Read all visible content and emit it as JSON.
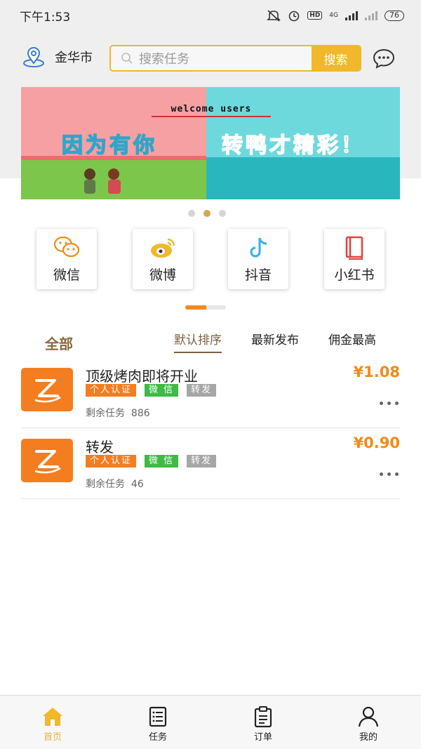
{
  "status_bar": {
    "time": "下午1:53",
    "network": "4G",
    "hd": "HD",
    "battery": "76"
  },
  "header": {
    "city": "金华市",
    "search_placeholder": "搜索任务",
    "search_button": "搜索"
  },
  "banner": {
    "welcome": "welcome users",
    "slogan_left": "因为有你",
    "slogan_right": "转鸭才精彩！",
    "page_count": 3,
    "active_page": 2
  },
  "platforms": [
    {
      "label": "微信",
      "icon": "wechat-icon"
    },
    {
      "label": "微博",
      "icon": "weibo-icon"
    },
    {
      "label": "抖音",
      "icon": "douyin-icon"
    },
    {
      "label": "小红书",
      "icon": "xiaohongshu-icon"
    }
  ],
  "filter": {
    "all_label": "全部",
    "tabs": [
      "默认排序",
      "最新发布",
      "佣金最高"
    ],
    "active_tab": 0
  },
  "tasks": [
    {
      "title": "顶级烤肉即将开业",
      "price": "¥1.08",
      "tags": [
        "个人认证",
        "微 信",
        "转发"
      ],
      "remaining_label": "剩余任务",
      "remaining": "886"
    },
    {
      "title": "转发",
      "price": "¥0.90",
      "tags": [
        "个人认证",
        "微 信",
        "转发"
      ],
      "remaining_label": "剩余任务",
      "remaining": "46"
    }
  ],
  "tabbar": [
    {
      "label": "首页",
      "icon": "home-icon",
      "active": true
    },
    {
      "label": "任务",
      "icon": "task-list-icon",
      "active": false
    },
    {
      "label": "订单",
      "icon": "order-icon",
      "active": false
    },
    {
      "label": "我的",
      "icon": "profile-icon",
      "active": false
    }
  ],
  "colors": {
    "accent": "#f0b82a",
    "price": "#f28a1a",
    "tag_orange": "#f47d20",
    "tag_green": "#3fba44",
    "tag_gray": "#a6a6a6",
    "tab_active": "#e9b23a"
  }
}
